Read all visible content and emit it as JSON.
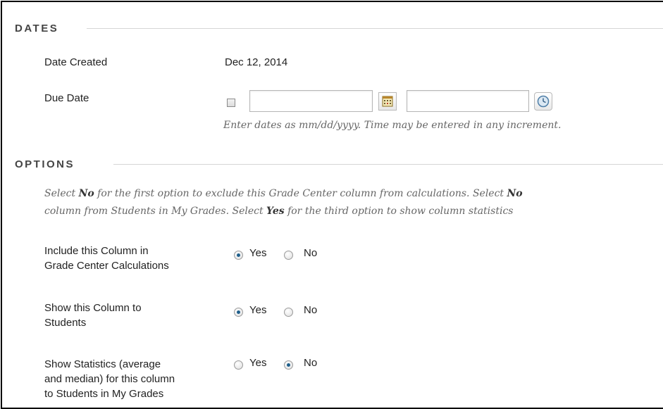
{
  "dates": {
    "title": "DATES",
    "date_created_label": "Date Created",
    "date_created_value": "Dec 12, 2014",
    "due_date_label": "Due Date",
    "due_date_checked": false,
    "due_date_value": "",
    "due_time_value": "",
    "hint": "Enter dates as mm/dd/yyyy. Time may be entered in any increment."
  },
  "options": {
    "title": "OPTIONS",
    "description": {
      "line1_a": "Select ",
      "line1_b": "No",
      "line1_c": " for the first option to exclude this Grade Center column from calculations. Select ",
      "line1_d": "No",
      "line2_a": "column from Students in My Grades. Select ",
      "line2_b": "Yes",
      "line2_c": " for the third option to show column statistics"
    },
    "rows": [
      {
        "label_lines": [
          "Include this Column in",
          "Grade Center Calculations"
        ],
        "yes": "Yes",
        "no": "No",
        "selected": "yes"
      },
      {
        "label_lines": [
          "Show this Column to",
          "Students"
        ],
        "yes": "Yes",
        "no": "No",
        "selected": "yes"
      },
      {
        "label_lines": [
          "Show Statistics (average",
          "and median) for this column",
          "to Students in My Grades"
        ],
        "yes": "Yes",
        "no": "No",
        "selected": "no"
      }
    ]
  }
}
